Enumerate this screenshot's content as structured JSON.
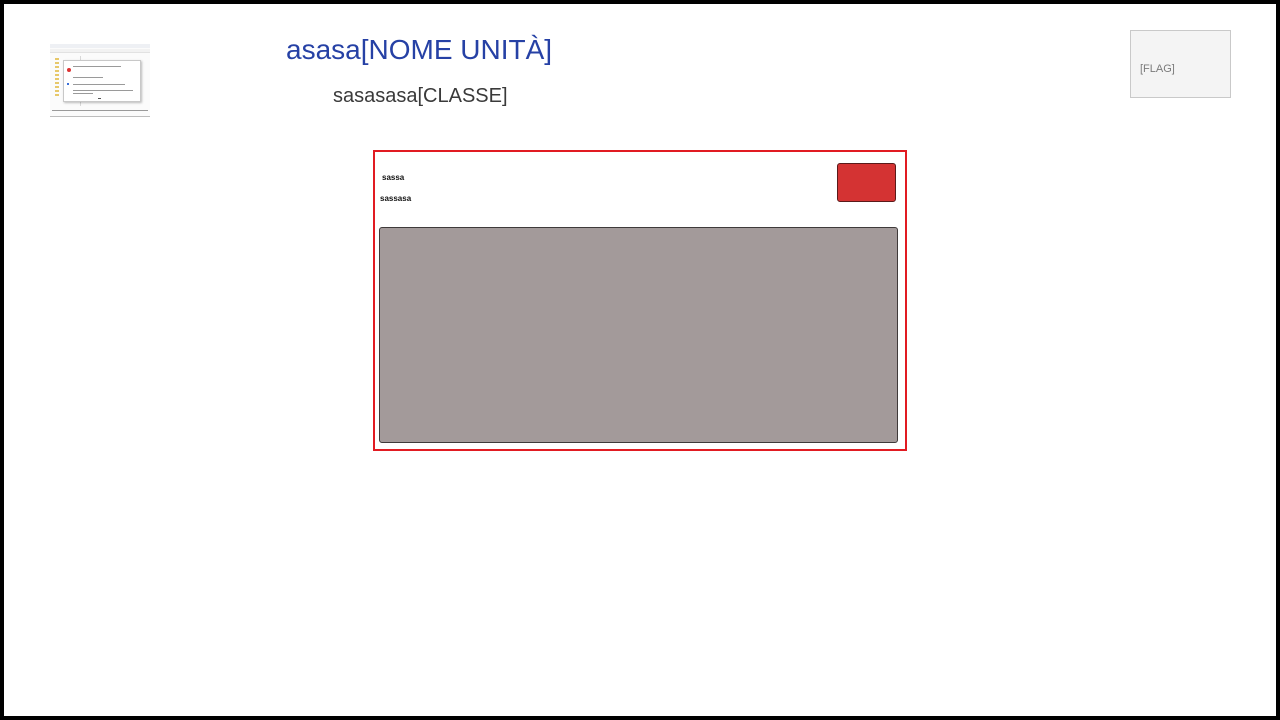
{
  "header": {
    "title": "asasa[NOME UNITÀ]",
    "subtitle": "sasasasa[CLASSE]",
    "flag_placeholder": "[FLAG]",
    "thumbnail_icon": "screenshot-thumbnail"
  },
  "panel": {
    "line1": "sassa",
    "line2": "sassasa",
    "button_label": ""
  },
  "colors": {
    "title": "#2641a5",
    "panel_border": "#e11b22",
    "button": "#d43333",
    "content_area": "#a39a9a"
  }
}
